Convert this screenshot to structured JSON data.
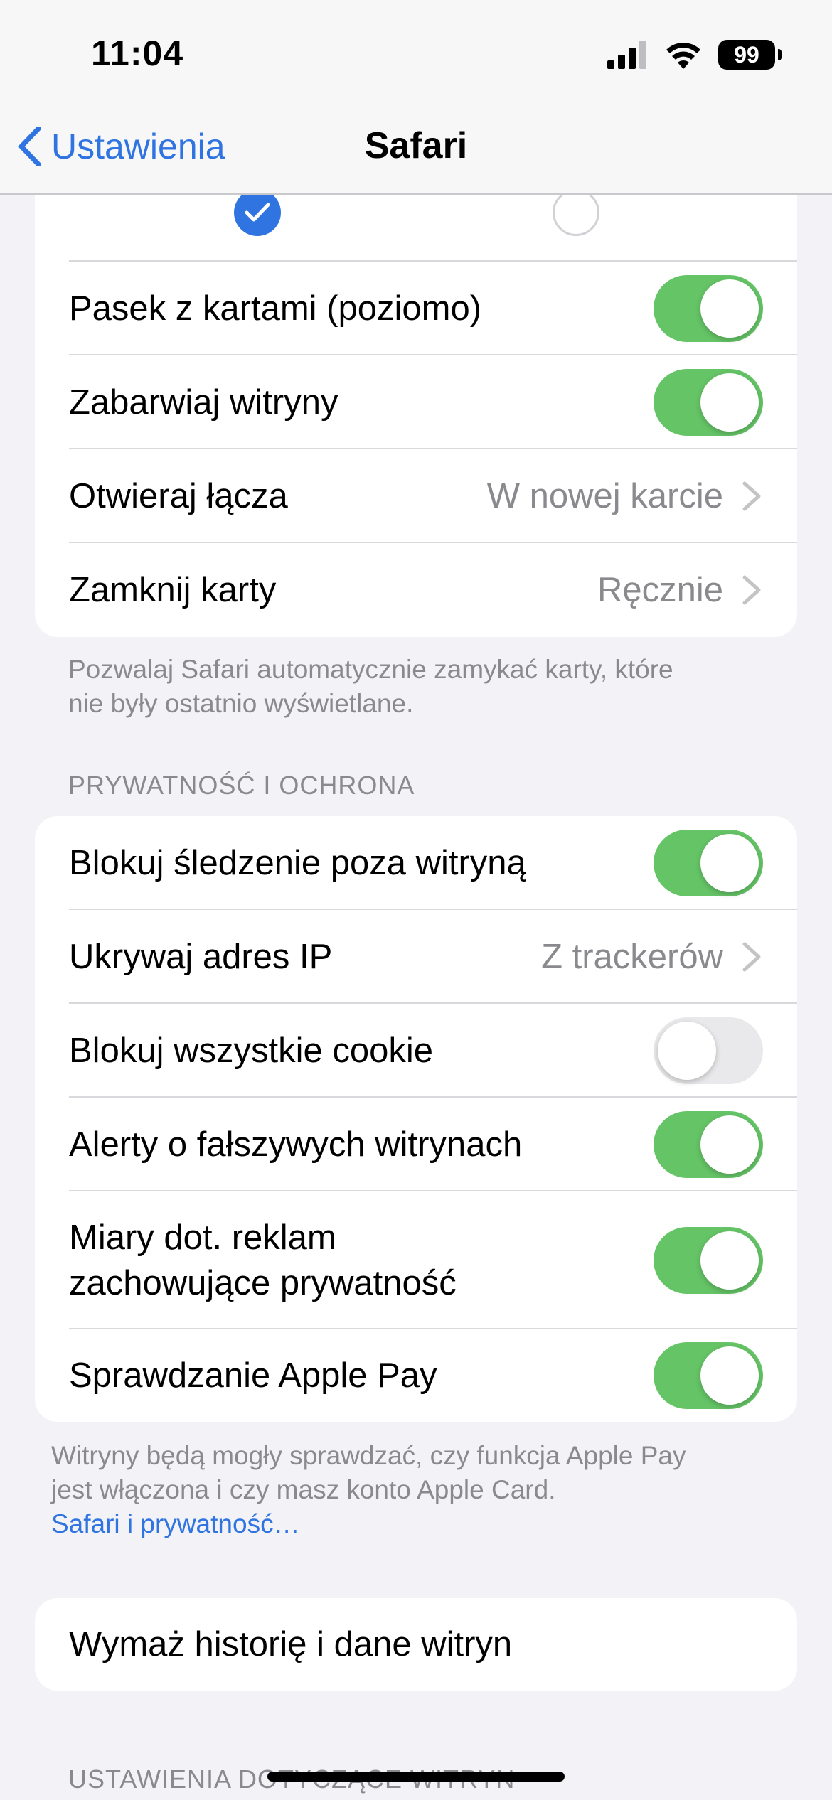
{
  "status_bar": {
    "time": "11:04",
    "battery": "99"
  },
  "nav": {
    "back_label": "Ustawienia",
    "title": "Safari"
  },
  "tabs_group": {
    "rows": [
      {
        "label": "Pasek z kartami (poziomo)",
        "on": true
      },
      {
        "label": "Zabarwiaj witryny",
        "on": true
      },
      {
        "label": "Otwieraj łącza",
        "value": "W nowej karcie"
      },
      {
        "label": "Zamknij karty",
        "value": "Ręcznie"
      }
    ],
    "footer_line1": "Pozwalaj Safari automatycznie zamykać karty, które",
    "footer_line2": "nie były ostatnio wyświetlane."
  },
  "privacy": {
    "header": "PRYWATNOŚĆ I OCHRONA",
    "rows": [
      {
        "label": "Blokuj śledzenie poza witryną",
        "on": true
      },
      {
        "label": "Ukrywaj adres IP",
        "value": "Z trackerów"
      },
      {
        "label": "Blokuj wszystkie cookie",
        "on": false
      },
      {
        "label": "Alerty o fałszywych witrynach",
        "on": true
      },
      {
        "label_line1": "Miary dot. reklam",
        "label_line2": "zachowujące prywatność",
        "on": true
      },
      {
        "label": "Sprawdzanie Apple Pay",
        "on": true
      }
    ],
    "footer_line1": "Witryny będą mogły sprawdzać, czy funkcja Apple Pay",
    "footer_line2": "jest włączona i czy masz konto Apple Card.",
    "footer_link": "Safari i prywatność…"
  },
  "clear_history": {
    "label": "Wymaż historię i dane witryn"
  },
  "website_settings": {
    "header": "USTAWIENIA DOTYCZĄCE WITRYN"
  },
  "colors": {
    "accent": "#2f74e0",
    "toggle_on": "#65c466",
    "toggle_off": "#e9e9eb",
    "secondary_text": "#8a8a8e",
    "background": "#f2f2f7"
  }
}
